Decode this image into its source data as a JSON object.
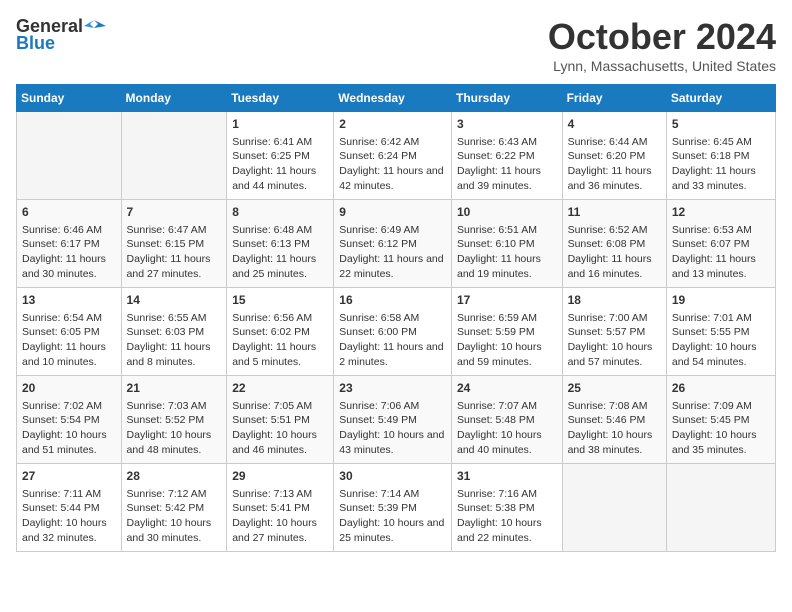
{
  "header": {
    "logo_general": "General",
    "logo_blue": "Blue",
    "month": "October 2024",
    "location": "Lynn, Massachusetts, United States"
  },
  "days_of_week": [
    "Sunday",
    "Monday",
    "Tuesday",
    "Wednesday",
    "Thursday",
    "Friday",
    "Saturday"
  ],
  "weeks": [
    [
      {
        "day": null
      },
      {
        "day": null
      },
      {
        "day": "1",
        "sunrise": "Sunrise: 6:41 AM",
        "sunset": "Sunset: 6:25 PM",
        "daylight": "Daylight: 11 hours and 44 minutes."
      },
      {
        "day": "2",
        "sunrise": "Sunrise: 6:42 AM",
        "sunset": "Sunset: 6:24 PM",
        "daylight": "Daylight: 11 hours and 42 minutes."
      },
      {
        "day": "3",
        "sunrise": "Sunrise: 6:43 AM",
        "sunset": "Sunset: 6:22 PM",
        "daylight": "Daylight: 11 hours and 39 minutes."
      },
      {
        "day": "4",
        "sunrise": "Sunrise: 6:44 AM",
        "sunset": "Sunset: 6:20 PM",
        "daylight": "Daylight: 11 hours and 36 minutes."
      },
      {
        "day": "5",
        "sunrise": "Sunrise: 6:45 AM",
        "sunset": "Sunset: 6:18 PM",
        "daylight": "Daylight: 11 hours and 33 minutes."
      }
    ],
    [
      {
        "day": "6",
        "sunrise": "Sunrise: 6:46 AM",
        "sunset": "Sunset: 6:17 PM",
        "daylight": "Daylight: 11 hours and 30 minutes."
      },
      {
        "day": "7",
        "sunrise": "Sunrise: 6:47 AM",
        "sunset": "Sunset: 6:15 PM",
        "daylight": "Daylight: 11 hours and 27 minutes."
      },
      {
        "day": "8",
        "sunrise": "Sunrise: 6:48 AM",
        "sunset": "Sunset: 6:13 PM",
        "daylight": "Daylight: 11 hours and 25 minutes."
      },
      {
        "day": "9",
        "sunrise": "Sunrise: 6:49 AM",
        "sunset": "Sunset: 6:12 PM",
        "daylight": "Daylight: 11 hours and 22 minutes."
      },
      {
        "day": "10",
        "sunrise": "Sunrise: 6:51 AM",
        "sunset": "Sunset: 6:10 PM",
        "daylight": "Daylight: 11 hours and 19 minutes."
      },
      {
        "day": "11",
        "sunrise": "Sunrise: 6:52 AM",
        "sunset": "Sunset: 6:08 PM",
        "daylight": "Daylight: 11 hours and 16 minutes."
      },
      {
        "day": "12",
        "sunrise": "Sunrise: 6:53 AM",
        "sunset": "Sunset: 6:07 PM",
        "daylight": "Daylight: 11 hours and 13 minutes."
      }
    ],
    [
      {
        "day": "13",
        "sunrise": "Sunrise: 6:54 AM",
        "sunset": "Sunset: 6:05 PM",
        "daylight": "Daylight: 11 hours and 10 minutes."
      },
      {
        "day": "14",
        "sunrise": "Sunrise: 6:55 AM",
        "sunset": "Sunset: 6:03 PM",
        "daylight": "Daylight: 11 hours and 8 minutes."
      },
      {
        "day": "15",
        "sunrise": "Sunrise: 6:56 AM",
        "sunset": "Sunset: 6:02 PM",
        "daylight": "Daylight: 11 hours and 5 minutes."
      },
      {
        "day": "16",
        "sunrise": "Sunrise: 6:58 AM",
        "sunset": "Sunset: 6:00 PM",
        "daylight": "Daylight: 11 hours and 2 minutes."
      },
      {
        "day": "17",
        "sunrise": "Sunrise: 6:59 AM",
        "sunset": "Sunset: 5:59 PM",
        "daylight": "Daylight: 10 hours and 59 minutes."
      },
      {
        "day": "18",
        "sunrise": "Sunrise: 7:00 AM",
        "sunset": "Sunset: 5:57 PM",
        "daylight": "Daylight: 10 hours and 57 minutes."
      },
      {
        "day": "19",
        "sunrise": "Sunrise: 7:01 AM",
        "sunset": "Sunset: 5:55 PM",
        "daylight": "Daylight: 10 hours and 54 minutes."
      }
    ],
    [
      {
        "day": "20",
        "sunrise": "Sunrise: 7:02 AM",
        "sunset": "Sunset: 5:54 PM",
        "daylight": "Daylight: 10 hours and 51 minutes."
      },
      {
        "day": "21",
        "sunrise": "Sunrise: 7:03 AM",
        "sunset": "Sunset: 5:52 PM",
        "daylight": "Daylight: 10 hours and 48 minutes."
      },
      {
        "day": "22",
        "sunrise": "Sunrise: 7:05 AM",
        "sunset": "Sunset: 5:51 PM",
        "daylight": "Daylight: 10 hours and 46 minutes."
      },
      {
        "day": "23",
        "sunrise": "Sunrise: 7:06 AM",
        "sunset": "Sunset: 5:49 PM",
        "daylight": "Daylight: 10 hours and 43 minutes."
      },
      {
        "day": "24",
        "sunrise": "Sunrise: 7:07 AM",
        "sunset": "Sunset: 5:48 PM",
        "daylight": "Daylight: 10 hours and 40 minutes."
      },
      {
        "day": "25",
        "sunrise": "Sunrise: 7:08 AM",
        "sunset": "Sunset: 5:46 PM",
        "daylight": "Daylight: 10 hours and 38 minutes."
      },
      {
        "day": "26",
        "sunrise": "Sunrise: 7:09 AM",
        "sunset": "Sunset: 5:45 PM",
        "daylight": "Daylight: 10 hours and 35 minutes."
      }
    ],
    [
      {
        "day": "27",
        "sunrise": "Sunrise: 7:11 AM",
        "sunset": "Sunset: 5:44 PM",
        "daylight": "Daylight: 10 hours and 32 minutes."
      },
      {
        "day": "28",
        "sunrise": "Sunrise: 7:12 AM",
        "sunset": "Sunset: 5:42 PM",
        "daylight": "Daylight: 10 hours and 30 minutes."
      },
      {
        "day": "29",
        "sunrise": "Sunrise: 7:13 AM",
        "sunset": "Sunset: 5:41 PM",
        "daylight": "Daylight: 10 hours and 27 minutes."
      },
      {
        "day": "30",
        "sunrise": "Sunrise: 7:14 AM",
        "sunset": "Sunset: 5:39 PM",
        "daylight": "Daylight: 10 hours and 25 minutes."
      },
      {
        "day": "31",
        "sunrise": "Sunrise: 7:16 AM",
        "sunset": "Sunset: 5:38 PM",
        "daylight": "Daylight: 10 hours and 22 minutes."
      },
      {
        "day": null
      },
      {
        "day": null
      }
    ]
  ]
}
